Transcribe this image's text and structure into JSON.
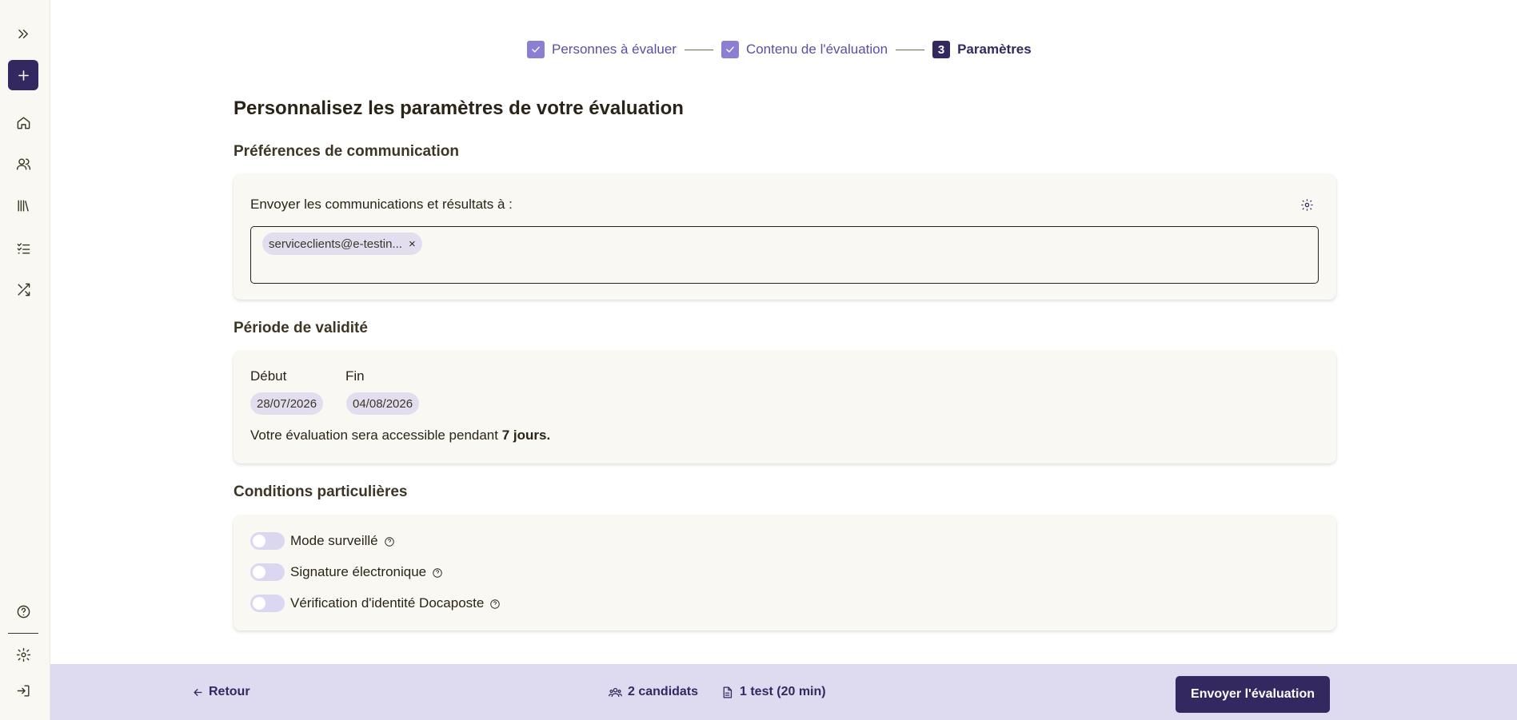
{
  "sidebar": {
    "items": [
      {
        "name": "expand-icon"
      },
      {
        "name": "plus-icon"
      },
      {
        "name": "home-icon"
      },
      {
        "name": "users-icon"
      },
      {
        "name": "library-icon"
      },
      {
        "name": "checklist-icon"
      },
      {
        "name": "shuffle-icon"
      },
      {
        "name": "help-icon"
      },
      {
        "name": "gear-icon"
      },
      {
        "name": "logout-icon"
      }
    ]
  },
  "stepper": {
    "step1": "Personnes à évaluer",
    "step2": "Contenu de l'évaluation",
    "step3_number": "3",
    "step3": "Paramètres"
  },
  "page": {
    "title": "Personnalisez les paramètres de votre évaluation"
  },
  "communication": {
    "section_title": "Préférences de communication",
    "label": "Envoyer les communications et résultats à :",
    "email_chip": "serviceclients@e-testin...",
    "chip_remove": "×"
  },
  "validity": {
    "section_title": "Période de validité",
    "start_label": "Début",
    "end_label": "Fin",
    "start_date": "28/07/2026",
    "end_date": "04/08/2026",
    "text_prefix": "Votre évaluation sera accessible pendant ",
    "duration": "7 jours."
  },
  "conditions": {
    "section_title": "Conditions particulières",
    "toggles": [
      {
        "label": "Mode surveillé",
        "on": false
      },
      {
        "label": "Signature électronique",
        "on": false
      },
      {
        "label": "Vérification d'identité Docaposte",
        "on": false
      }
    ]
  },
  "footer": {
    "back_label": "Retour",
    "candidates": "2 candidats",
    "tests": "1 test (20 min)",
    "send_label": "Envoyer l'évaluation"
  },
  "colors": {
    "primary": "#33285f",
    "accent": "#8b7fd3",
    "footer_bg": "#dedaf0",
    "card_bg": "#faf8f2"
  }
}
